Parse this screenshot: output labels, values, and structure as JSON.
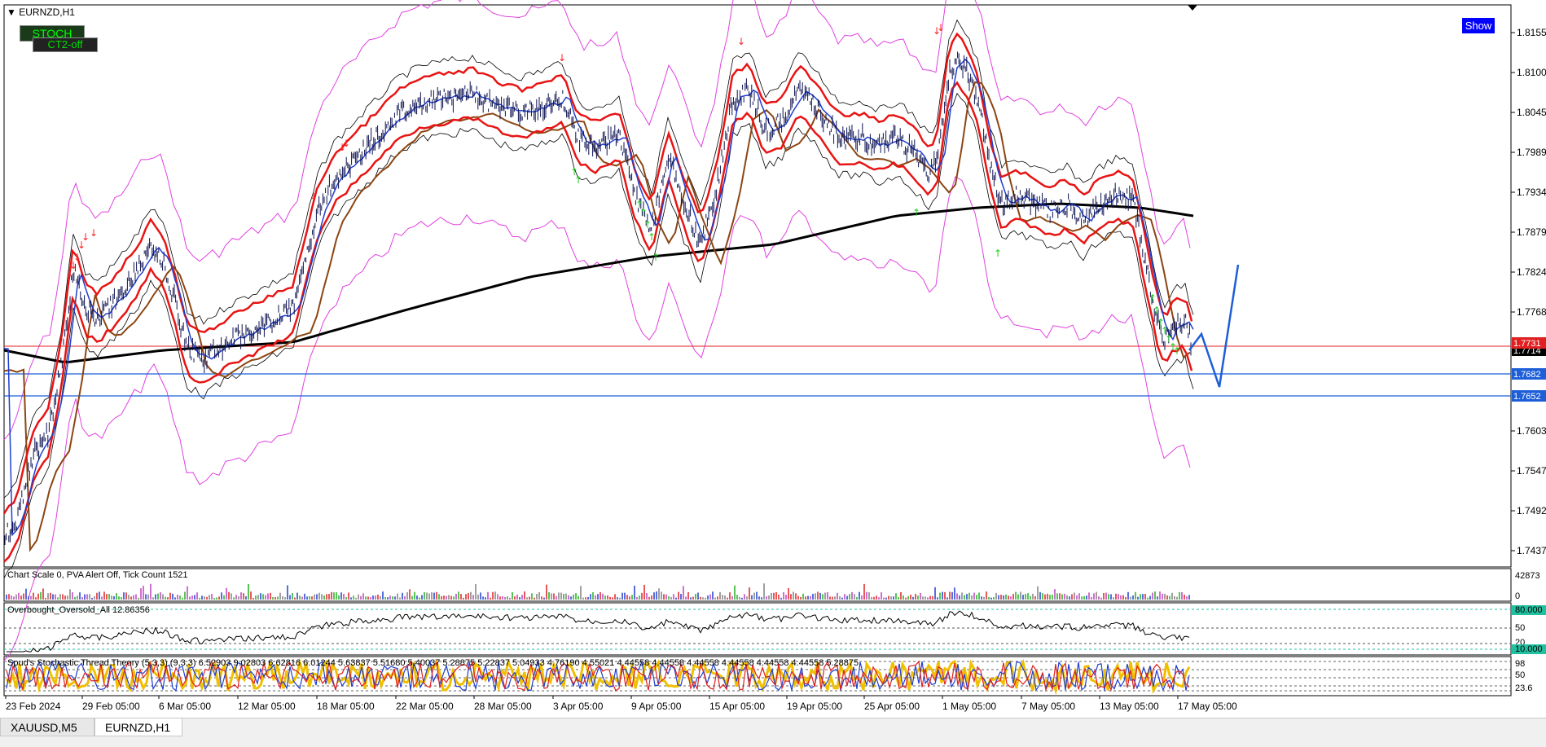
{
  "window": {
    "symbol_title": "EURNZD,H1"
  },
  "buttons": {
    "stoch": "STOCH",
    "ct": "CT2-off",
    "show": "Show"
  },
  "price_axis": {
    "ticks": [
      "1.8155",
      "1.8100",
      "1.8045",
      "1.7989",
      "1.7934",
      "1.7879",
      "1.7824",
      "1.7768",
      "1.7603",
      "1.7547",
      "1.7492",
      "1.7437"
    ],
    "tags": [
      {
        "text": "1.7714",
        "color": "#000000"
      },
      {
        "text": "1.7682",
        "color": "#1e5fd8"
      },
      {
        "text": "1.7652",
        "color": "#1e5fd8"
      },
      {
        "text": "1.7731",
        "color": "#e02020"
      }
    ]
  },
  "volume_panel": {
    "info": "Chart Scale  0,   PVA Alert Off,   Tick Count  1521",
    "scale_top": "42873",
    "scale_bottom": "0"
  },
  "obos_panel": {
    "label": "Overbought_Oversold_All 12.86356",
    "scale": [
      "80.000",
      "50",
      "20",
      "10.000"
    ]
  },
  "stoch_panel": {
    "label": "Spud's Stochastic Thread Theory (5,3,3) (9,3,3) 6.52903 9.02803 6.62816 6.01244 5.63837 5.51680 5.40037 5.28875 5.22837 5.04933 4.76190 4.55021 4.44558 4.44558 4.44558 4.44558 4.44558 4.44558 5.28875",
    "scale": [
      "98",
      "50",
      "23.6"
    ]
  },
  "time_axis": [
    "23 Feb 2024",
    "29 Feb 05:00",
    "6 Mar 05:00",
    "12 Mar 05:00",
    "18 Mar 05:00",
    "22 Mar 05:00",
    "28 Mar 05:00",
    "3 Apr 05:00",
    "9 Apr 05:00",
    "15 Apr 05:00",
    "19 Apr 05:00",
    "25 Apr 05:00",
    "1 May 05:00",
    "7 May 05:00",
    "13 May 05:00",
    "17 May 05:00"
  ],
  "tabs": [
    {
      "label": "XAUUSD,M5"
    },
    {
      "label": "EURNZD,H1"
    }
  ],
  "colors": {
    "price": "#0d1250",
    "ma_red": "#e81414",
    "bb_magenta": "#e040e0",
    "ma_brown": "#8b4513",
    "ma_black": "#000000",
    "ma_blue": "#1f3fd0",
    "forecast": "#1e5fd8",
    "stoch_yellow": "#f0c000"
  }
}
